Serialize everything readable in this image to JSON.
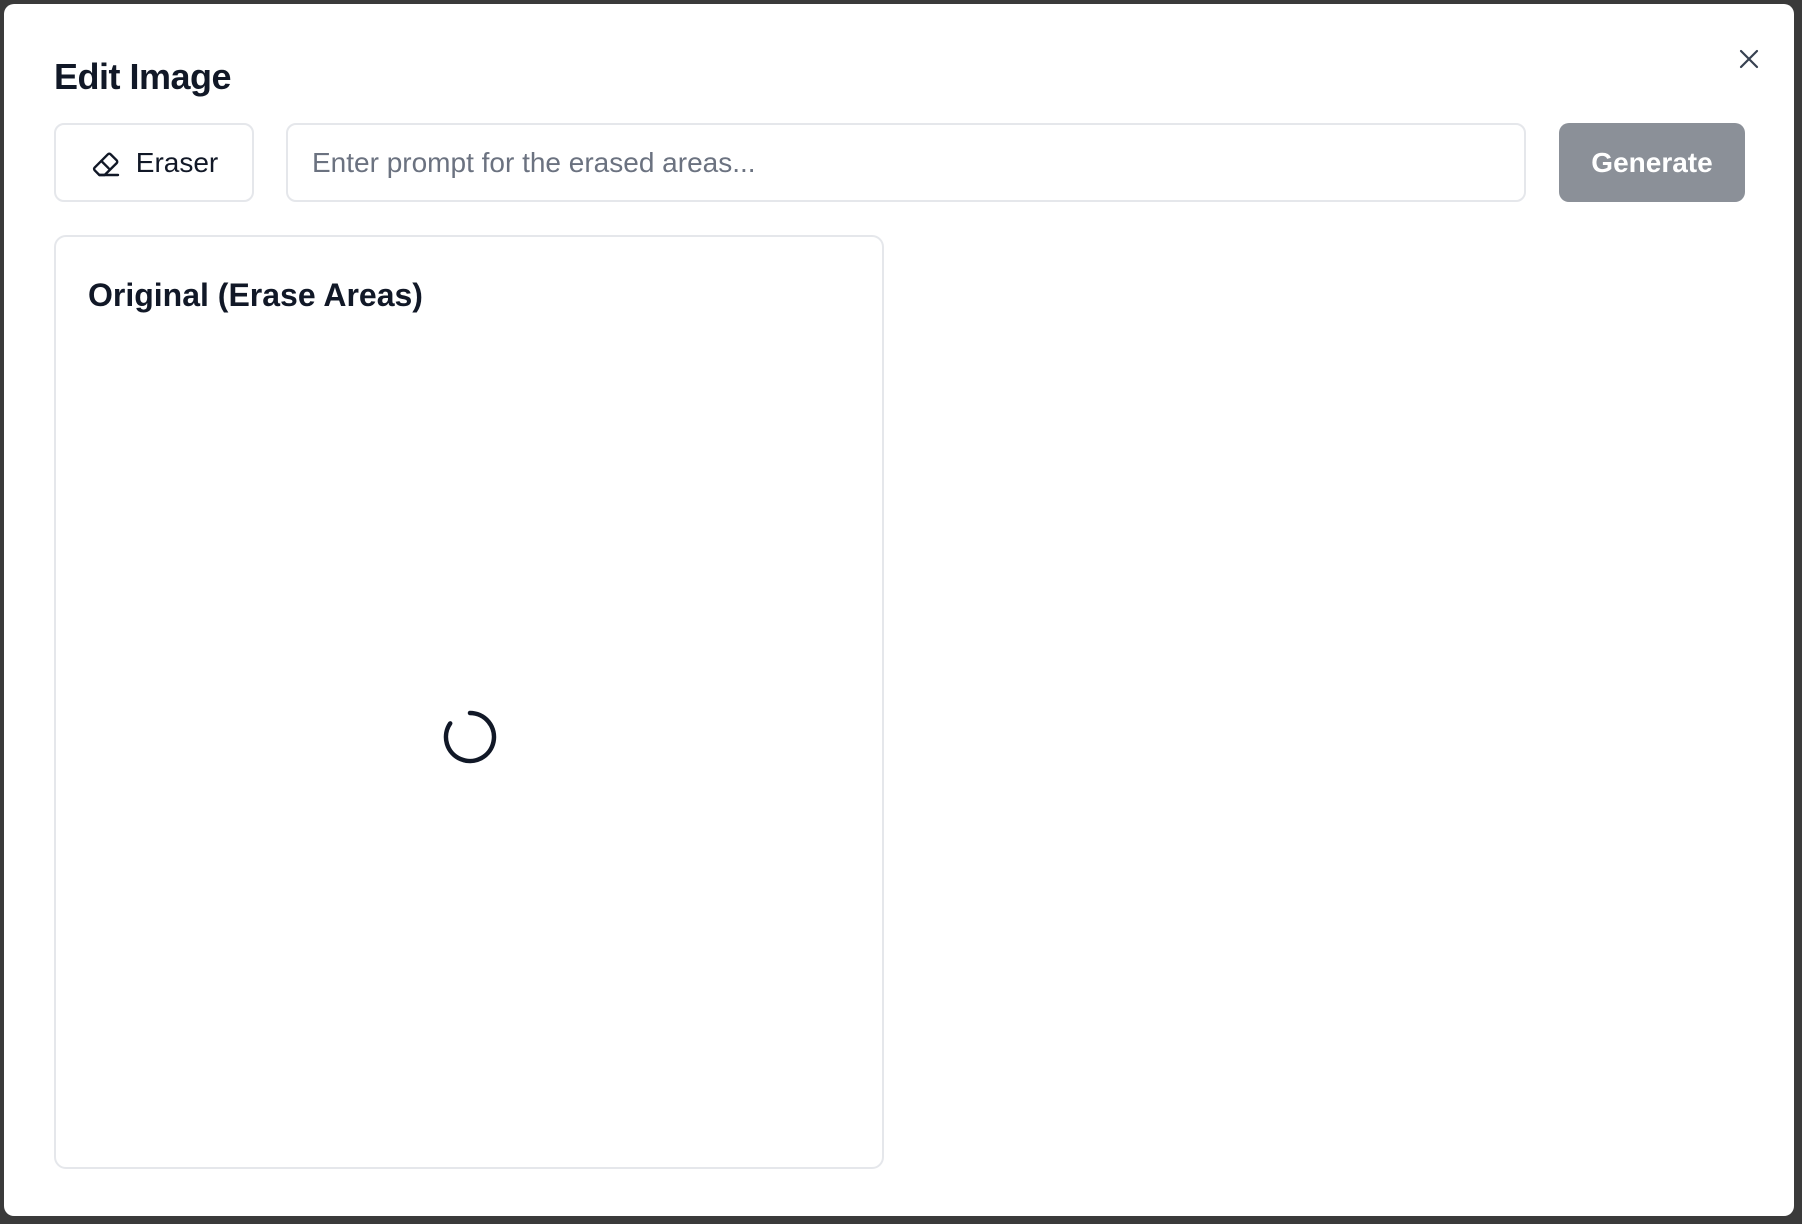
{
  "modal": {
    "title": "Edit Image",
    "close_icon": "close-icon"
  },
  "toolbar": {
    "eraser_label": "Eraser",
    "eraser_icon": "eraser-icon",
    "prompt_placeholder": "Enter prompt for the erased areas...",
    "prompt_value": "",
    "generate_label": "Generate"
  },
  "panel": {
    "title": "Original (Erase Areas)",
    "loading_icon": "spinner-icon"
  },
  "colors": {
    "generate_bg": "#8b9098",
    "border": "#e5e7eb",
    "text": "#111827",
    "placeholder": "#6b7280"
  }
}
